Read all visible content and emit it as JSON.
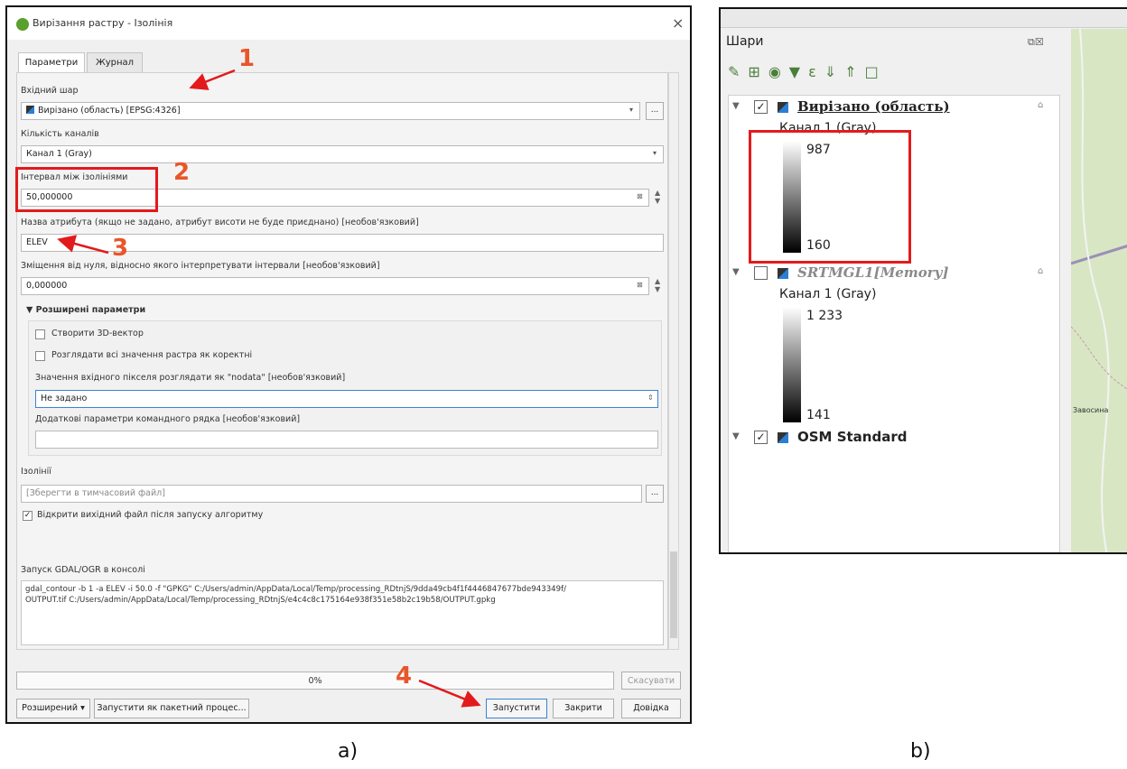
{
  "dialog": {
    "title": "Вирізання растру - Ізолінія",
    "close_symbol": "×",
    "tabs": [
      {
        "label": "Параметри"
      },
      {
        "label": "Журнал"
      }
    ],
    "input_layer": {
      "label": "Вхідний шар",
      "value": "Вирізано (область) [EPSG:4326]",
      "browse_label": "..."
    },
    "band": {
      "label": "Кількість каналів",
      "value": "Канал 1 (Gray)"
    },
    "interval": {
      "label": "Інтервал між ізолініями",
      "value": "50,000000"
    },
    "attribute": {
      "label": "Назва атрибута (якщо не задано, атрибут висоти не буде приєднано) [необов'язковий]",
      "value": "ELEV"
    },
    "offset": {
      "label": "Зміщення від нуля, відносно якого інтерпретувати інтервали [необов'язковий]",
      "value": "0,000000"
    },
    "advanced": {
      "header": "Розширені параметри",
      "create_3d_label": "Створити 3D-вектор",
      "treat_all_valid_label": "Розглядати всі значення растра як коректні",
      "nodata_label": "Значення вхідного пікселя розглядати як \"nodata\" [необов'язковий]",
      "nodata_value": "Не задано",
      "extra_params_label": "Додаткові параметри командного рядка [необов'язковий]",
      "extra_params_value": ""
    },
    "output": {
      "label": "Ізолінії",
      "placeholder": "[Зберегти в тимчасовий файл]",
      "browse_label": "...",
      "open_after_label": "Відкрити вихідний файл після запуску алгоритму",
      "open_after_checked": true
    },
    "console": {
      "label": "Запуск GDAL/OGR в консолі",
      "command_line1": "gdal_contour -b 1 -a ELEV -i 50.0 -f \"GPKG\" C:/Users/admin/AppData/Local/Temp/processing_RDtnjS/9dda49cb4f1f4446847677bde943349f/",
      "command_line2": "OUTPUT.tif C:/Users/admin/AppData/Local/Temp/processing_RDtnjS/e4c4c8c175164e938f351e58b2c19b58/OUTPUT.gpkg"
    },
    "progress": {
      "value_text": "0%",
      "fraction": 0.0,
      "cancel_label": "Скасувати"
    },
    "buttons": {
      "advanced": "Розширений",
      "batch": "Запустити як пакетний процес...",
      "run": "Запустити",
      "close": "Закрити",
      "help": "Довідка"
    },
    "annotations": [
      "1",
      "2",
      "3",
      "4"
    ],
    "accent_red": "#e31a1c",
    "annotation_color": "#e8562a"
  },
  "layers_panel": {
    "title": "Шари",
    "layers": [
      {
        "name": "Вирізано (область)",
        "checked": true,
        "band": "Канал 1 (Gray)",
        "max": "987",
        "min": "160"
      },
      {
        "name": "SRTMGL1[Memory]",
        "checked": false,
        "band": "Канал 1 (Gray)",
        "max": "1 233",
        "min": "141"
      },
      {
        "name": "OSM Standard",
        "checked": true
      }
    ],
    "map_labels": [
      "Завосина"
    ]
  },
  "captions": {
    "a": "a)",
    "b": "b)"
  }
}
